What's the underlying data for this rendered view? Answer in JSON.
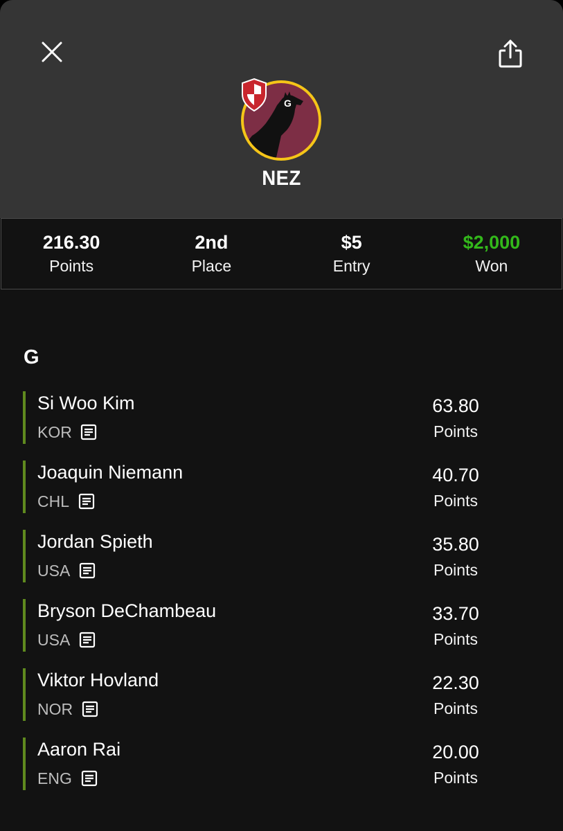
{
  "header": {
    "username": "NEZ",
    "avatar_letter": "G"
  },
  "stats": [
    {
      "value": "216.30",
      "label": "Points"
    },
    {
      "value": "2nd",
      "label": "Place"
    },
    {
      "value": "$5",
      "label": "Entry"
    },
    {
      "value": "$2,000",
      "label": "Won",
      "color": "#33b81b"
    }
  ],
  "lineup": {
    "section_title": "G",
    "players": [
      {
        "name": "Si Woo Kim",
        "country": "KOR",
        "points": "63.80",
        "points_label": "Points"
      },
      {
        "name": "Joaquin Niemann",
        "country": "CHL",
        "points": "40.70",
        "points_label": "Points"
      },
      {
        "name": "Jordan Spieth",
        "country": "USA",
        "points": "35.80",
        "points_label": "Points"
      },
      {
        "name": "Bryson DeChambeau",
        "country": "USA",
        "points": "33.70",
        "points_label": "Points"
      },
      {
        "name": "Viktor Hovland",
        "country": "NOR",
        "points": "22.30",
        "points_label": "Points"
      },
      {
        "name": "Aaron Rai",
        "country": "ENG",
        "points": "20.00",
        "points_label": "Points"
      }
    ]
  },
  "colors": {
    "accent_green": "#33b81b",
    "position_bar": "#5f8a1e",
    "avatar_ring": "#f5c518",
    "avatar_bg": "#7d2e45",
    "badge_red": "#c8262e"
  },
  "icons": {
    "close": "close-icon",
    "share": "share-icon",
    "news": "news-icon",
    "badge": "shield-badge-icon"
  }
}
